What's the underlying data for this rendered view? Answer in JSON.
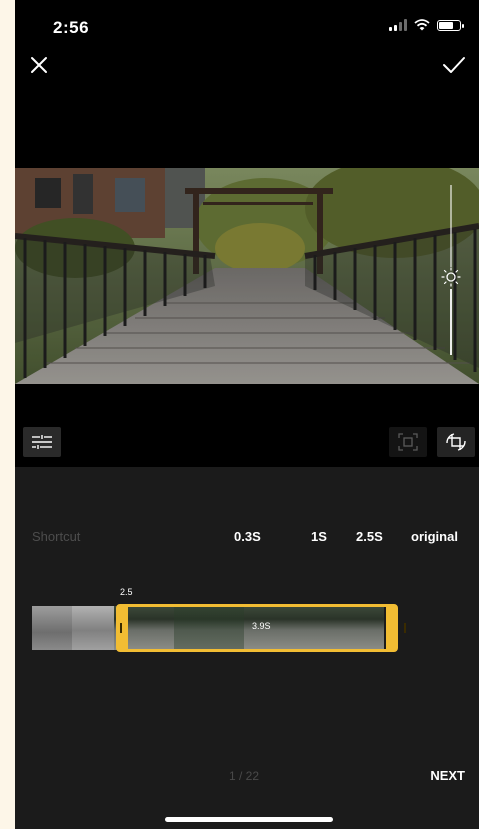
{
  "status_bar": {
    "time": "2:56",
    "icons": [
      "cellular-signal-icon",
      "wifi-icon",
      "battery-icon"
    ]
  },
  "top_bar": {
    "close_icon": "close-icon",
    "confirm_icon": "checkmark-icon"
  },
  "tools": {
    "adjust_icon": "adjust-sliders-icon",
    "fit_icon": "fit-frame-icon",
    "crop_icon": "crop-rotate-icon",
    "brightness_icon": "brightness-sun-icon"
  },
  "speed": {
    "label": "Shortcut",
    "options": [
      "0.3S",
      "1S",
      "2.5S",
      "original"
    ]
  },
  "trim": {
    "start_label": "2.5",
    "duration_label": "3.9S"
  },
  "footer": {
    "page_counter": "1 / 22",
    "next_label": "NEXT"
  },
  "colors": {
    "accent": "#f2bd33",
    "panel_bg": "#1b1b1b",
    "muted_text": "#4d4d4d"
  }
}
